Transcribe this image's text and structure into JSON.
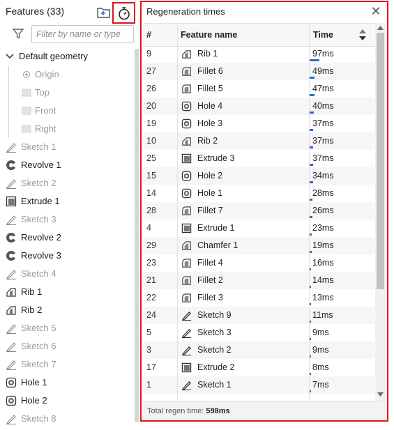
{
  "features_panel": {
    "title": "Features (33)",
    "filter_placeholder": "Filter by name or type",
    "items": [
      {
        "label": "Default geometry",
        "icon": "chevron-down-icon",
        "style": "dark",
        "indent": 0
      },
      {
        "label": "Origin",
        "icon": "origin-icon",
        "style": "dim",
        "indent": 2
      },
      {
        "label": "Top",
        "icon": "plane-icon",
        "style": "dim",
        "indent": 2
      },
      {
        "label": "Front",
        "icon": "plane-icon",
        "style": "dim",
        "indent": 2
      },
      {
        "label": "Right",
        "icon": "plane-icon",
        "style": "dim",
        "indent": 2
      },
      {
        "label": "Sketch 1",
        "icon": "sketch-icon",
        "style": "dim",
        "indent": 1
      },
      {
        "label": "Revolve 1",
        "icon": "revolve-icon",
        "style": "dark",
        "indent": 1
      },
      {
        "label": "Sketch 2",
        "icon": "sketch-icon",
        "style": "dim",
        "indent": 1
      },
      {
        "label": "Extrude 1",
        "icon": "extrude-icon",
        "style": "dark",
        "indent": 1
      },
      {
        "label": "Sketch 3",
        "icon": "sketch-icon",
        "style": "dim",
        "indent": 1
      },
      {
        "label": "Revolve 2",
        "icon": "revolve-icon",
        "style": "dark",
        "indent": 1
      },
      {
        "label": "Revolve 3",
        "icon": "revolve-icon",
        "style": "dark",
        "indent": 1
      },
      {
        "label": "Sketch 4",
        "icon": "sketch-icon",
        "style": "dim",
        "indent": 1
      },
      {
        "label": "Rib 1",
        "icon": "rib-icon",
        "style": "dark",
        "indent": 1
      },
      {
        "label": "Rib 2",
        "icon": "rib-icon",
        "style": "dark",
        "indent": 1
      },
      {
        "label": "Sketch 5",
        "icon": "sketch-icon",
        "style": "dim",
        "indent": 1
      },
      {
        "label": "Sketch 6",
        "icon": "sketch-icon",
        "style": "dim",
        "indent": 1
      },
      {
        "label": "Sketch 7",
        "icon": "sketch-icon",
        "style": "dim",
        "indent": 1
      },
      {
        "label": "Hole 1",
        "icon": "hole-icon",
        "style": "dark",
        "indent": 1
      },
      {
        "label": "Hole 2",
        "icon": "hole-icon",
        "style": "dark",
        "indent": 1
      },
      {
        "label": "Sketch 8",
        "icon": "sketch-icon",
        "style": "dim",
        "indent": 1
      }
    ]
  },
  "regen_panel": {
    "title": "Regeneration times",
    "columns": {
      "num": "#",
      "name": "Feature name",
      "time": "Time"
    },
    "rows": [
      {
        "num": "9",
        "icon": "rib-icon",
        "name": "Rib 1",
        "time": "97ms",
        "ms": 97
      },
      {
        "num": "27",
        "icon": "fillet-icon",
        "name": "Fillet 6",
        "time": "49ms",
        "ms": 49
      },
      {
        "num": "26",
        "icon": "fillet-icon",
        "name": "Fillet 5",
        "time": "47ms",
        "ms": 47
      },
      {
        "num": "20",
        "icon": "hole-icon",
        "name": "Hole 4",
        "time": "40ms",
        "ms": 40
      },
      {
        "num": "19",
        "icon": "hole-icon",
        "name": "Hole 3",
        "time": "37ms",
        "ms": 37
      },
      {
        "num": "10",
        "icon": "rib-icon",
        "name": "Rib 2",
        "time": "37ms",
        "ms": 37
      },
      {
        "num": "25",
        "icon": "extrude-icon",
        "name": "Extrude 3",
        "time": "37ms",
        "ms": 37
      },
      {
        "num": "15",
        "icon": "hole-icon",
        "name": "Hole 2",
        "time": "34ms",
        "ms": 34
      },
      {
        "num": "14",
        "icon": "hole-icon",
        "name": "Hole 1",
        "time": "28ms",
        "ms": 28
      },
      {
        "num": "28",
        "icon": "fillet-icon",
        "name": "Fillet 7",
        "time": "26ms",
        "ms": 26
      },
      {
        "num": "4",
        "icon": "extrude-icon",
        "name": "Extrude 1",
        "time": "23ms",
        "ms": 23
      },
      {
        "num": "29",
        "icon": "chamfer-icon",
        "name": "Chamfer 1",
        "time": "19ms",
        "ms": 19
      },
      {
        "num": "23",
        "icon": "fillet-icon",
        "name": "Fillet 4",
        "time": "16ms",
        "ms": 16
      },
      {
        "num": "21",
        "icon": "fillet-icon",
        "name": "Fillet 2",
        "time": "14ms",
        "ms": 14
      },
      {
        "num": "22",
        "icon": "fillet-icon",
        "name": "Fillet 3",
        "time": "13ms",
        "ms": 13
      },
      {
        "num": "24",
        "icon": "sketch-icon",
        "name": "Sketch 9",
        "time": "11ms",
        "ms": 11
      },
      {
        "num": "5",
        "icon": "sketch-icon",
        "name": "Sketch 3",
        "time": "9ms",
        "ms": 9
      },
      {
        "num": "3",
        "icon": "sketch-icon",
        "name": "Sketch 2",
        "time": "9ms",
        "ms": 9
      },
      {
        "num": "17",
        "icon": "extrude-icon",
        "name": "Extrude 2",
        "time": "8ms",
        "ms": 8
      },
      {
        "num": "1",
        "icon": "sketch-icon",
        "name": "Sketch 1",
        "time": "7ms",
        "ms": 7
      }
    ],
    "footer_label": "Total regen time:",
    "footer_value": "598ms"
  },
  "colors": {
    "highlight_border": "#e0121a",
    "bar": "#2b6cc4"
  }
}
